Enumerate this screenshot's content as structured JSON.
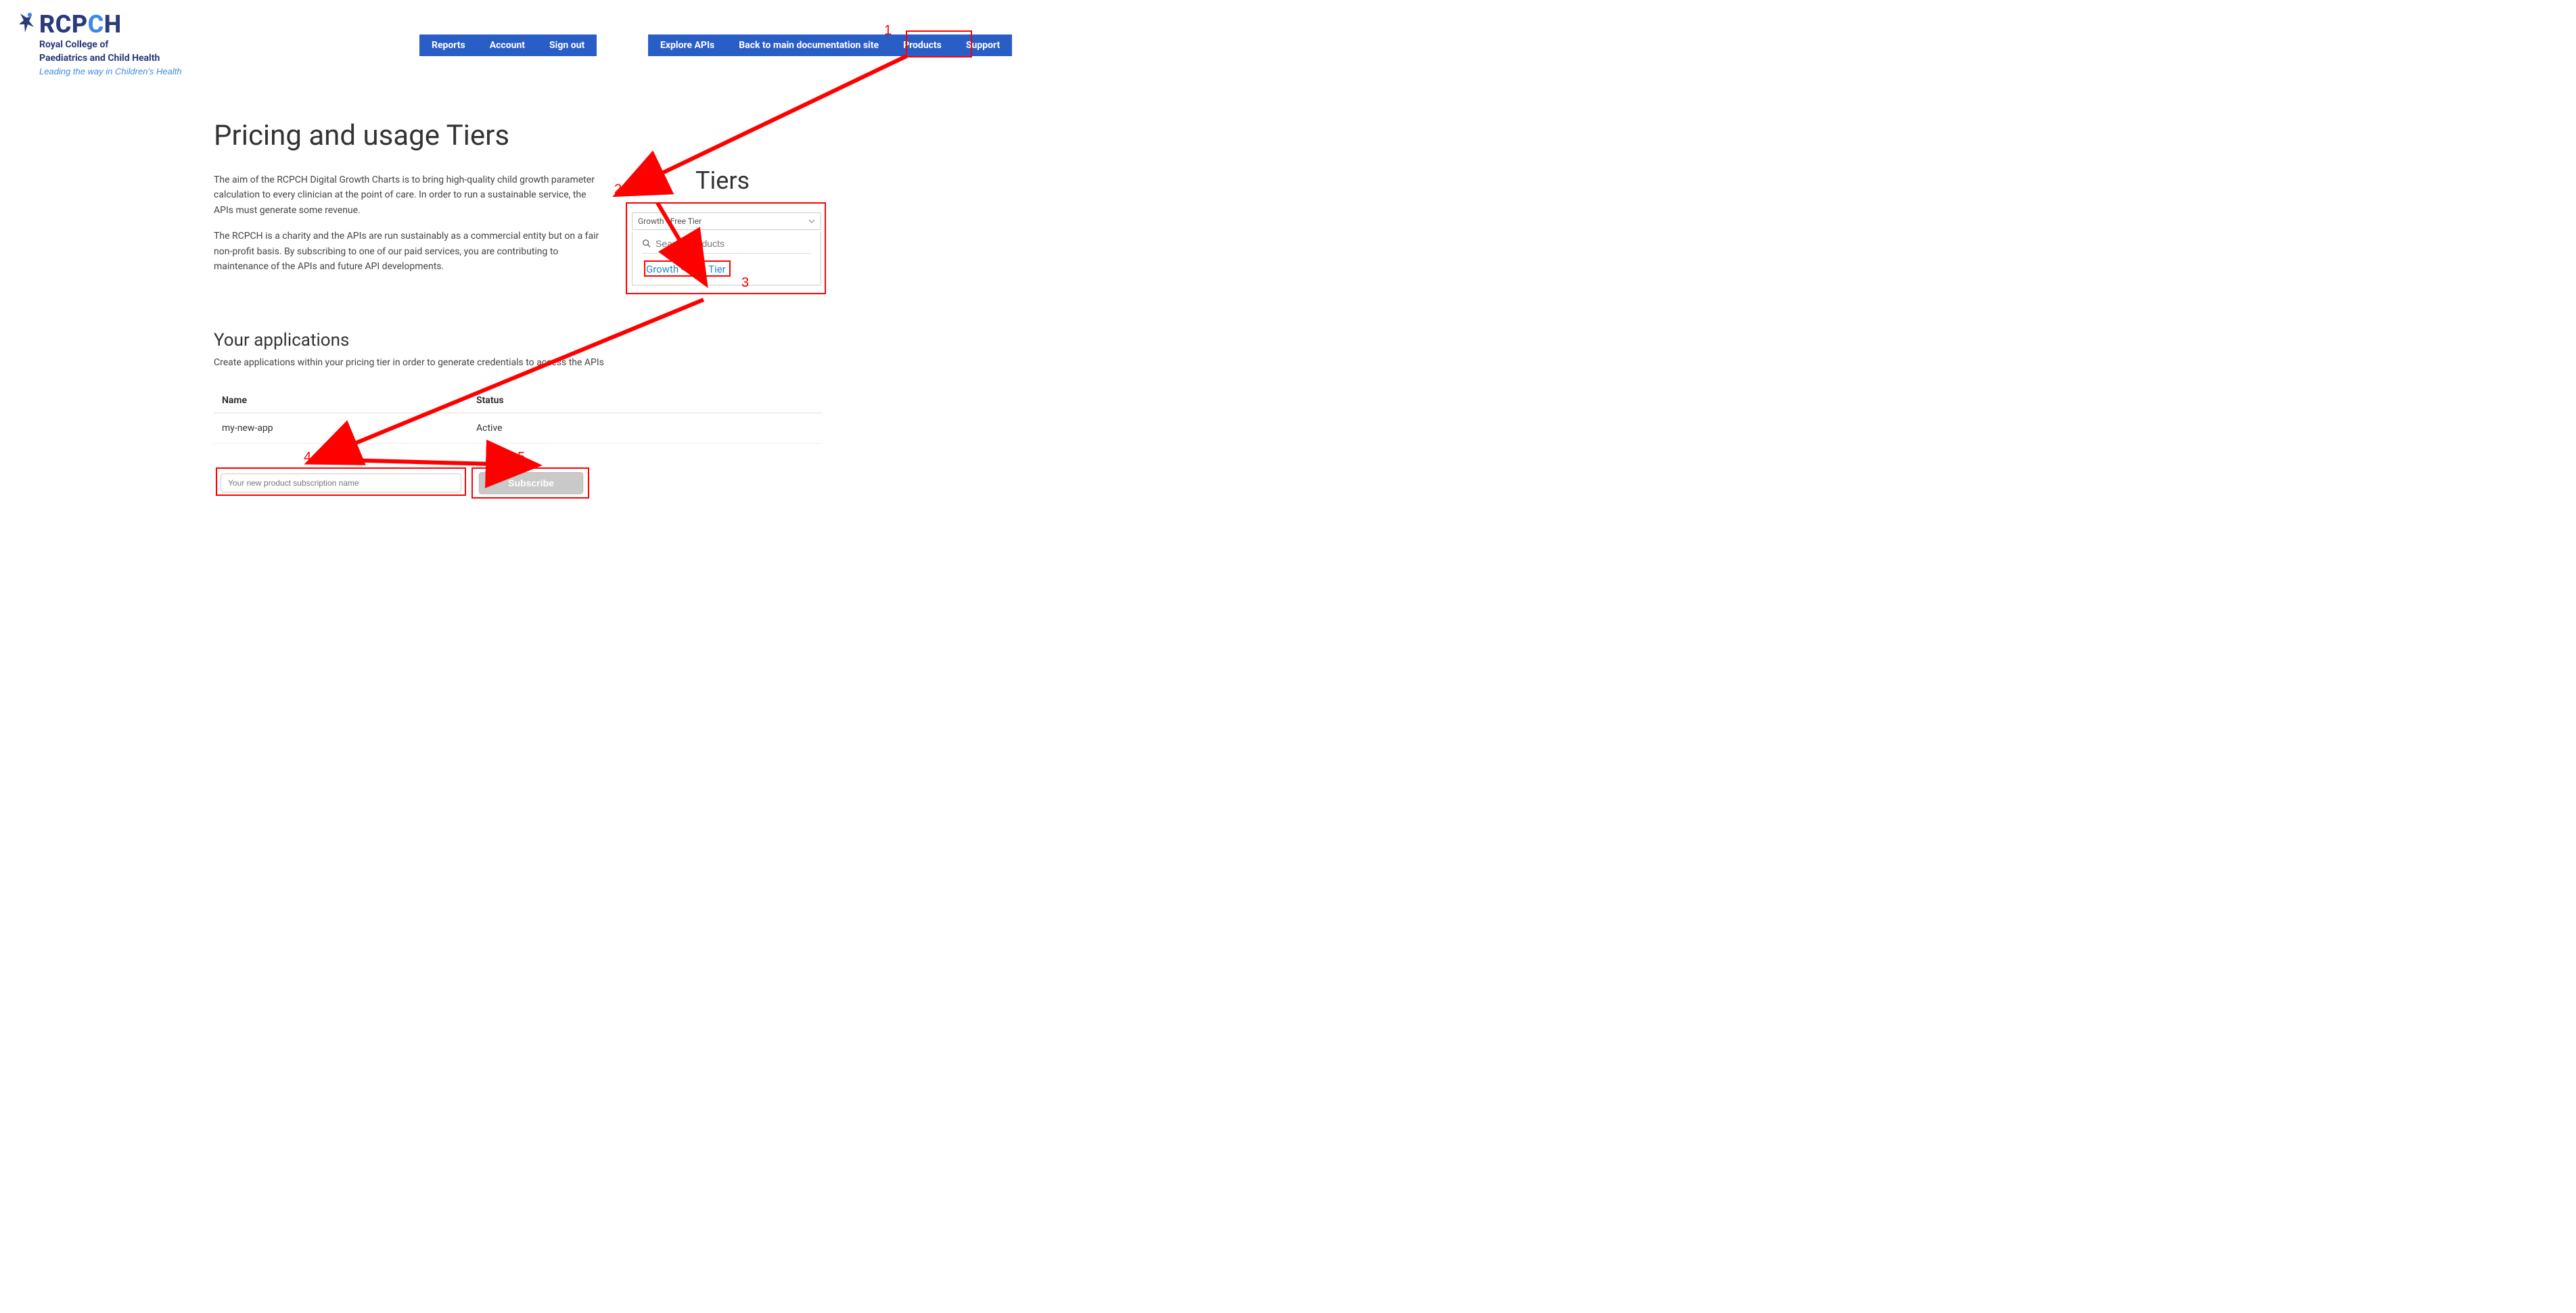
{
  "logo": {
    "brand_prefix": "RCP",
    "brand_letter": "C",
    "brand_suffix": "H",
    "line1a": "Royal College of",
    "line1b": "Paediatrics and Child Health",
    "tagline": "Leading the way in Children's Health"
  },
  "nav1": {
    "items": [
      "Reports",
      "Account",
      "Sign out"
    ]
  },
  "nav2": {
    "items": [
      "Explore APIs",
      "Back to main documentation site",
      "Products",
      "Support"
    ]
  },
  "page": {
    "title": "Pricing and usage Tiers",
    "p1": "The aim of the RCPCH Digital Growth Charts is to bring high-quality child growth parameter calculation to every clinician at the point of care. In order to run a sustainable service, the APIs must generate some revenue.",
    "p2": "The RCPCH is a charity and the APIs are run sustainably as a commercial entity but on a fair non-profit basis. By subscribing to one of our paid services, you are contributing to maintenance of the APIs and future API developments."
  },
  "tiers": {
    "title": "Tiers",
    "selected": "Growth - Free Tier",
    "search_placeholder": "Search products",
    "option": "Growth - Free Tier"
  },
  "apps": {
    "title": "Your applications",
    "subtitle": "Create applications within your pricing tier in order to generate credentials to access the APIs",
    "headers": {
      "name": "Name",
      "status": "Status"
    },
    "row": {
      "name": "my-new-app",
      "status": "Active"
    },
    "input_placeholder": "Your new product subscription name",
    "button": "Subscribe"
  },
  "annotations": {
    "n1": "1",
    "n2": "2",
    "n3": "3",
    "n4": "4",
    "n5": "5"
  }
}
